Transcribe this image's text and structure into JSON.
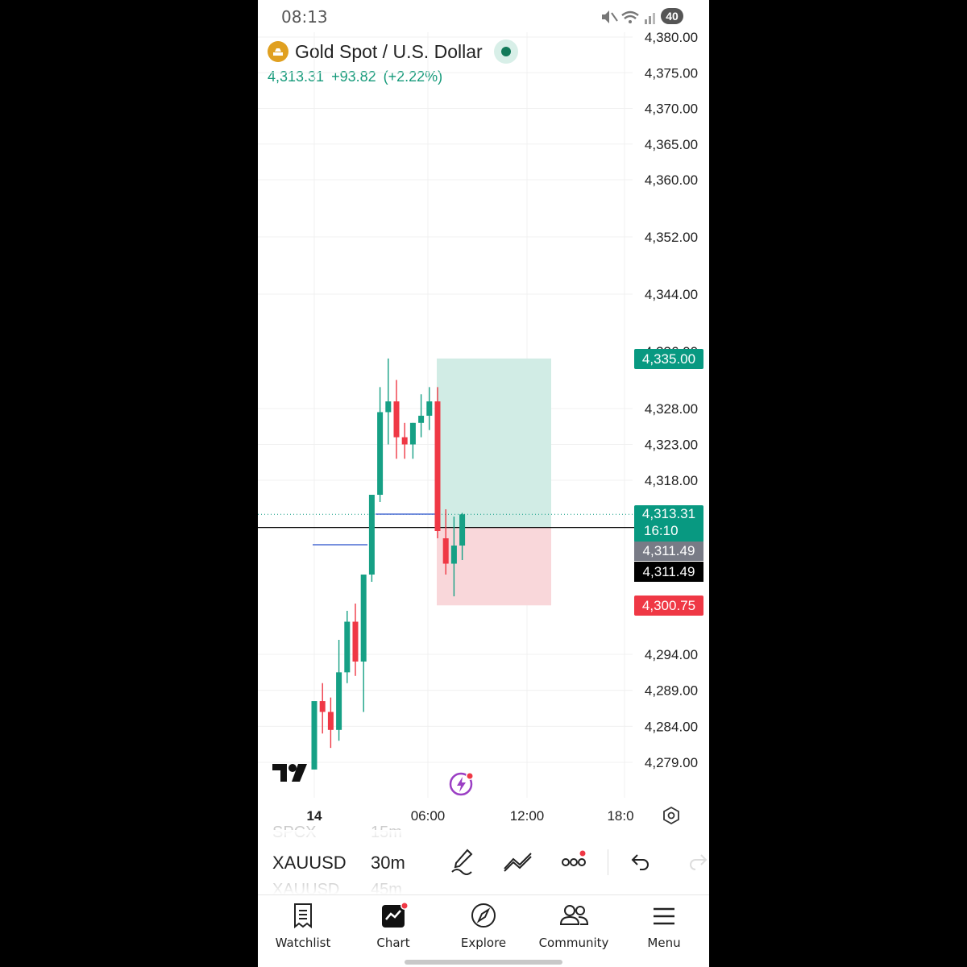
{
  "status_bar": {
    "time": "08:13",
    "battery": "40"
  },
  "symbol": {
    "title": "Gold Spot / U.S. Dollar",
    "price": "4,313.31",
    "change": "+93.82",
    "change_pct": "(+2.22%)"
  },
  "price_axis_labels": [
    "4,380.00",
    "4,375.00",
    "4,370.00",
    "4,365.00",
    "4,360.00",
    "4,352.00",
    "4,344.00",
    "4,328.00",
    "4,323.00",
    "4,318.00",
    "4,294.00",
    "4,289.00",
    "4,284.00",
    "4,279.00"
  ],
  "partial_axis_label": "4,336.00",
  "time_axis_labels": [
    "14",
    "06:00",
    "12:00",
    "18:0"
  ],
  "price_tags": {
    "target": "4,335.00",
    "last_price": "4,313.31",
    "countdown": "16:10",
    "crosshair_grey": "4,311.49",
    "crosshair_black": "4,311.49",
    "stop": "4,300.75"
  },
  "toolbar": {
    "symbol": "XAUUSD",
    "interval": "30m",
    "symbol_above": "SPCX",
    "interval_above": "15m",
    "symbol_below": "XAUUSD",
    "interval_below": "45m"
  },
  "nav": {
    "watchlist": "Watchlist",
    "chart": "Chart",
    "explore": "Explore",
    "community": "Community",
    "menu": "Menu"
  },
  "colors": {
    "up": "#16a085",
    "down": "#ef3845",
    "accent": "#089981"
  },
  "chart_data": {
    "type": "candlestick",
    "symbol": "XAUUSD",
    "interval": "30m",
    "y_axis_ticks": [
      4380,
      4375,
      4370,
      4365,
      4360,
      4352,
      4344,
      4328,
      4323,
      4318,
      4294,
      4289,
      4284,
      4279
    ],
    "last_price": 4313.31,
    "crosshair_price": 4311.49,
    "position": {
      "target": 4335.0,
      "stop": 4300.75
    },
    "candles": [
      {
        "o": 4278,
        "h": 4286,
        "l": 4278,
        "c": 4287.5
      },
      {
        "o": 4287.5,
        "h": 4290,
        "l": 4283,
        "c": 4286
      },
      {
        "o": 4286,
        "h": 4288,
        "l": 4281,
        "c": 4283.5
      },
      {
        "o": 4283.5,
        "h": 4296,
        "l": 4282,
        "c": 4291.5
      },
      {
        "o": 4291.5,
        "h": 4300,
        "l": 4290,
        "c": 4298.5
      },
      {
        "o": 4298.5,
        "h": 4301,
        "l": 4291,
        "c": 4293
      },
      {
        "o": 4293,
        "h": 4304,
        "l": 4286,
        "c": 4305
      },
      {
        "o": 4305,
        "h": 4315,
        "l": 4304,
        "c": 4316
      },
      {
        "o": 4316,
        "h": 4331,
        "l": 4315,
        "c": 4327.5
      },
      {
        "o": 4327.5,
        "h": 4335,
        "l": 4323,
        "c": 4329
      },
      {
        "o": 4329,
        "h": 4332,
        "l": 4321,
        "c": 4324
      },
      {
        "o": 4324,
        "h": 4326,
        "l": 4321,
        "c": 4323
      },
      {
        "o": 4323,
        "h": 4326,
        "l": 4321,
        "c": 4326
      },
      {
        "o": 4326,
        "h": 4330,
        "l": 4324,
        "c": 4327
      },
      {
        "o": 4327,
        "h": 4331,
        "l": 4325,
        "c": 4329
      },
      {
        "o": 4329,
        "h": 4331,
        "l": 4310,
        "c": 4311
      },
      {
        "o": 4310,
        "h": 4314,
        "l": 4305,
        "c": 4306.5
      },
      {
        "o": 4306.5,
        "h": 4313,
        "l": 4302,
        "c": 4309
      },
      {
        "o": 4309,
        "h": 4313.5,
        "l": 4307,
        "c": 4313.3
      }
    ]
  }
}
